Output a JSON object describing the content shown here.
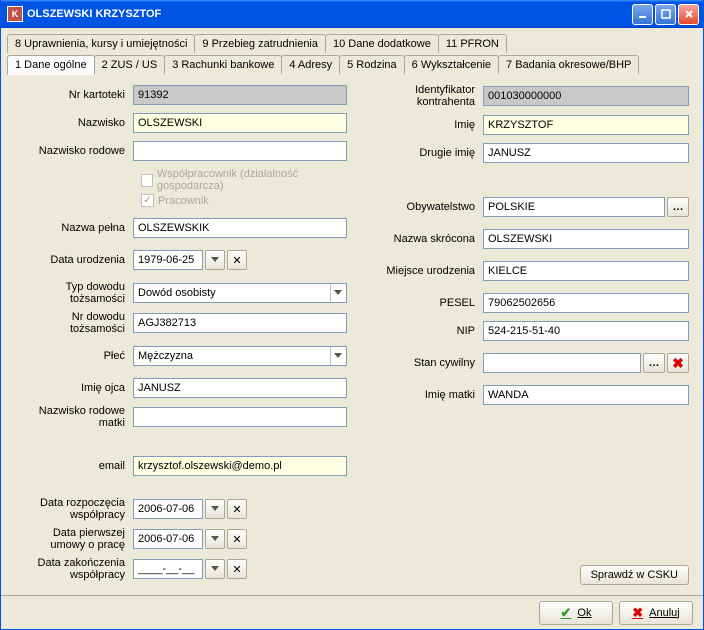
{
  "window": {
    "title": "OLSZEWSKI KRZYSZTOF"
  },
  "tabs_top": [
    "8 Uprawnienia, kursy i umiejętności",
    "9 Przebieg zatrudnienia",
    "10 Dane dodatkowe",
    "11 PFRON"
  ],
  "tabs_bottom": [
    "1 Dane ogólne",
    "2 ZUS / US",
    "3 Rachunki bankowe",
    "4 Adresy",
    "5 Rodzina",
    "6 Wykształcenie",
    "7 Badania okresowe/BHP"
  ],
  "labels": {
    "nr_kartoteki": "Nr kartoteki",
    "ident": "Identyfikator kontrahenta",
    "nazwisko": "Nazwisko",
    "imie": "Imię",
    "nazwisko_rodowe": "Nazwisko rodowe",
    "drugie_imie": "Drugie imię",
    "wspolpracownik": "Współpracownik (działalność gospodarcza)",
    "pracownik": "Pracownik",
    "obywatelstwo": "Obywatelstwo",
    "nazwa_pelna": "Nazwa pełna",
    "nazwa_skrocona": "Nazwa skrócona",
    "data_urodzenia": "Data urodzenia",
    "miejsce_urodzenia": "Miejsce urodzenia",
    "typ_dowodu": "Typ dowodu tożsamości",
    "pesel": "PESEL",
    "nr_dowodu": "Nr dowodu tożsamości",
    "nip": "NIP",
    "plec": "Płeć",
    "stan_cywilny": "Stan cywilny",
    "imie_ojca": "Imię ojca",
    "imie_matki": "Imię matki",
    "nazwisko_rodowe_matki": "Nazwisko rodowe matki",
    "email": "email",
    "data_rozpoczecia": "Data rozpoczęcia współpracy",
    "data_pierwszej_umowy": "Data pierwszej umowy o pracę",
    "data_zakonczenia": "Data zakończenia współpracy"
  },
  "values": {
    "nr_kartoteki": "91392",
    "ident": "001030000000",
    "nazwisko": "OLSZEWSKI",
    "imie": "KRZYSZTOF",
    "nazwisko_rodowe": "",
    "drugie_imie": "JANUSZ",
    "obywatelstwo": "POLSKIE",
    "nazwa_pelna": "OLSZEWSKIK",
    "nazwa_skrocona": "OLSZEWSKI",
    "data_urodzenia": "1979-06-25",
    "miejsce_urodzenia": "KIELCE",
    "typ_dowodu": "Dowód osobisty",
    "pesel": "79062502656",
    "nr_dowodu": "AGJ382713",
    "nip": "524-215-51-40",
    "plec": "Mężczyzna",
    "stan_cywilny": "",
    "imie_ojca": "JANUSZ",
    "imie_matki": "WANDA",
    "nazwisko_rodowe_matki": "",
    "email": "krzysztof.olszewski@demo.pl",
    "data_rozpoczecia": "2006-07-06",
    "data_pierwszej_umowy": "2006-07-06",
    "data_zakonczenia": "____-__-__"
  },
  "buttons": {
    "sprawdz": "Sprawdź w CSKU",
    "ok": "Ok",
    "anuluj": "Anuluj"
  }
}
